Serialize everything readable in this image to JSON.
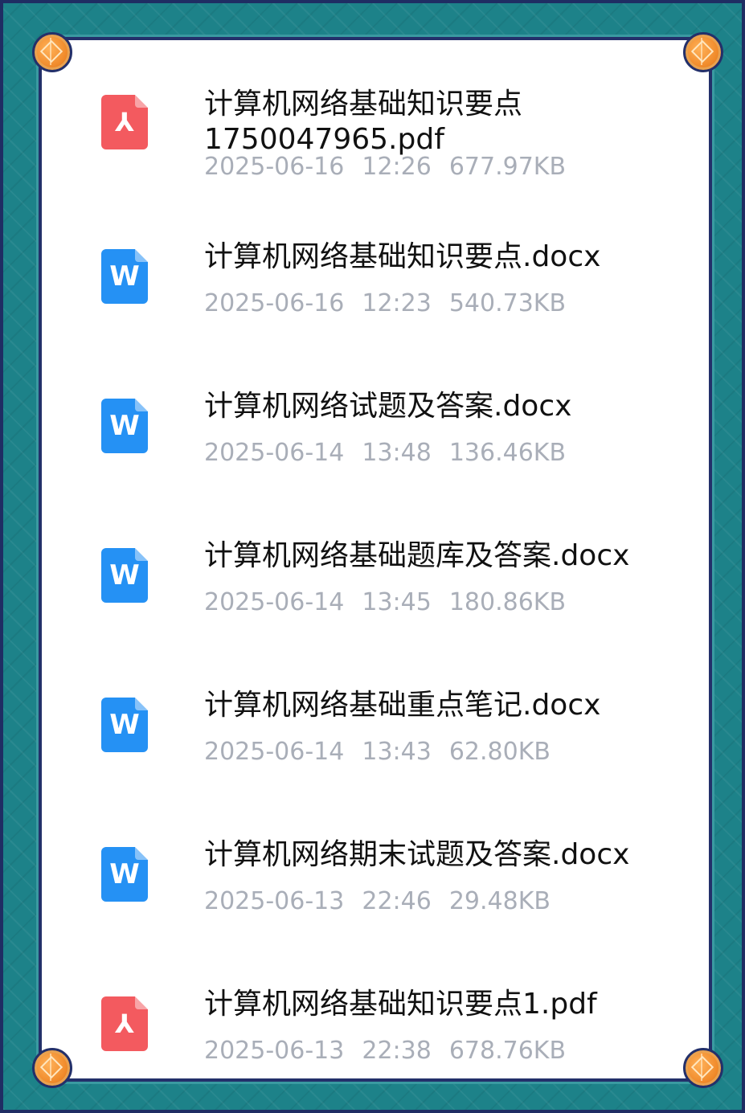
{
  "files": [
    {
      "type": "pdf",
      "icon": "pdf-file-icon",
      "name_line1": "计算机网络基础知识要点",
      "name_line2": "1750047965.pdf",
      "date": "2025-06-16",
      "time": "12:26",
      "size": "677.97KB"
    },
    {
      "type": "docx",
      "icon": "word-file-icon",
      "name_line1": "计算机网络基础知识要点.docx",
      "name_line2": "",
      "date": "2025-06-16",
      "time": "12:23",
      "size": "540.73KB"
    },
    {
      "type": "docx",
      "icon": "word-file-icon",
      "name_line1": "计算机网络试题及答案.docx",
      "name_line2": "",
      "date": "2025-06-14",
      "time": "13:48",
      "size": "136.46KB"
    },
    {
      "type": "docx",
      "icon": "word-file-icon",
      "name_line1": "计算机网络基础题库及答案.docx",
      "name_line2": "",
      "date": "2025-06-14",
      "time": "13:45",
      "size": "180.86KB"
    },
    {
      "type": "docx",
      "icon": "word-file-icon",
      "name_line1": "计算机网络基础重点笔记.docx",
      "name_line2": "",
      "date": "2025-06-14",
      "time": "13:43",
      "size": "62.80KB"
    },
    {
      "type": "docx",
      "icon": "word-file-icon",
      "name_line1": "计算机网络期末试题及答案.docx",
      "name_line2": "",
      "date": "2025-06-13",
      "time": "22:46",
      "size": "29.48KB"
    },
    {
      "type": "pdf",
      "icon": "pdf-file-icon",
      "name_line1": "计算机网络基础知识要点1.pdf",
      "name_line2": "",
      "date": "2025-06-13",
      "time": "22:38",
      "size": "678.76KB"
    }
  ],
  "colors": {
    "pdf_icon": "#f35a5f",
    "doc_icon": "#2591f4",
    "frame": "#1d8289",
    "meta_text": "#a9aeb8"
  }
}
